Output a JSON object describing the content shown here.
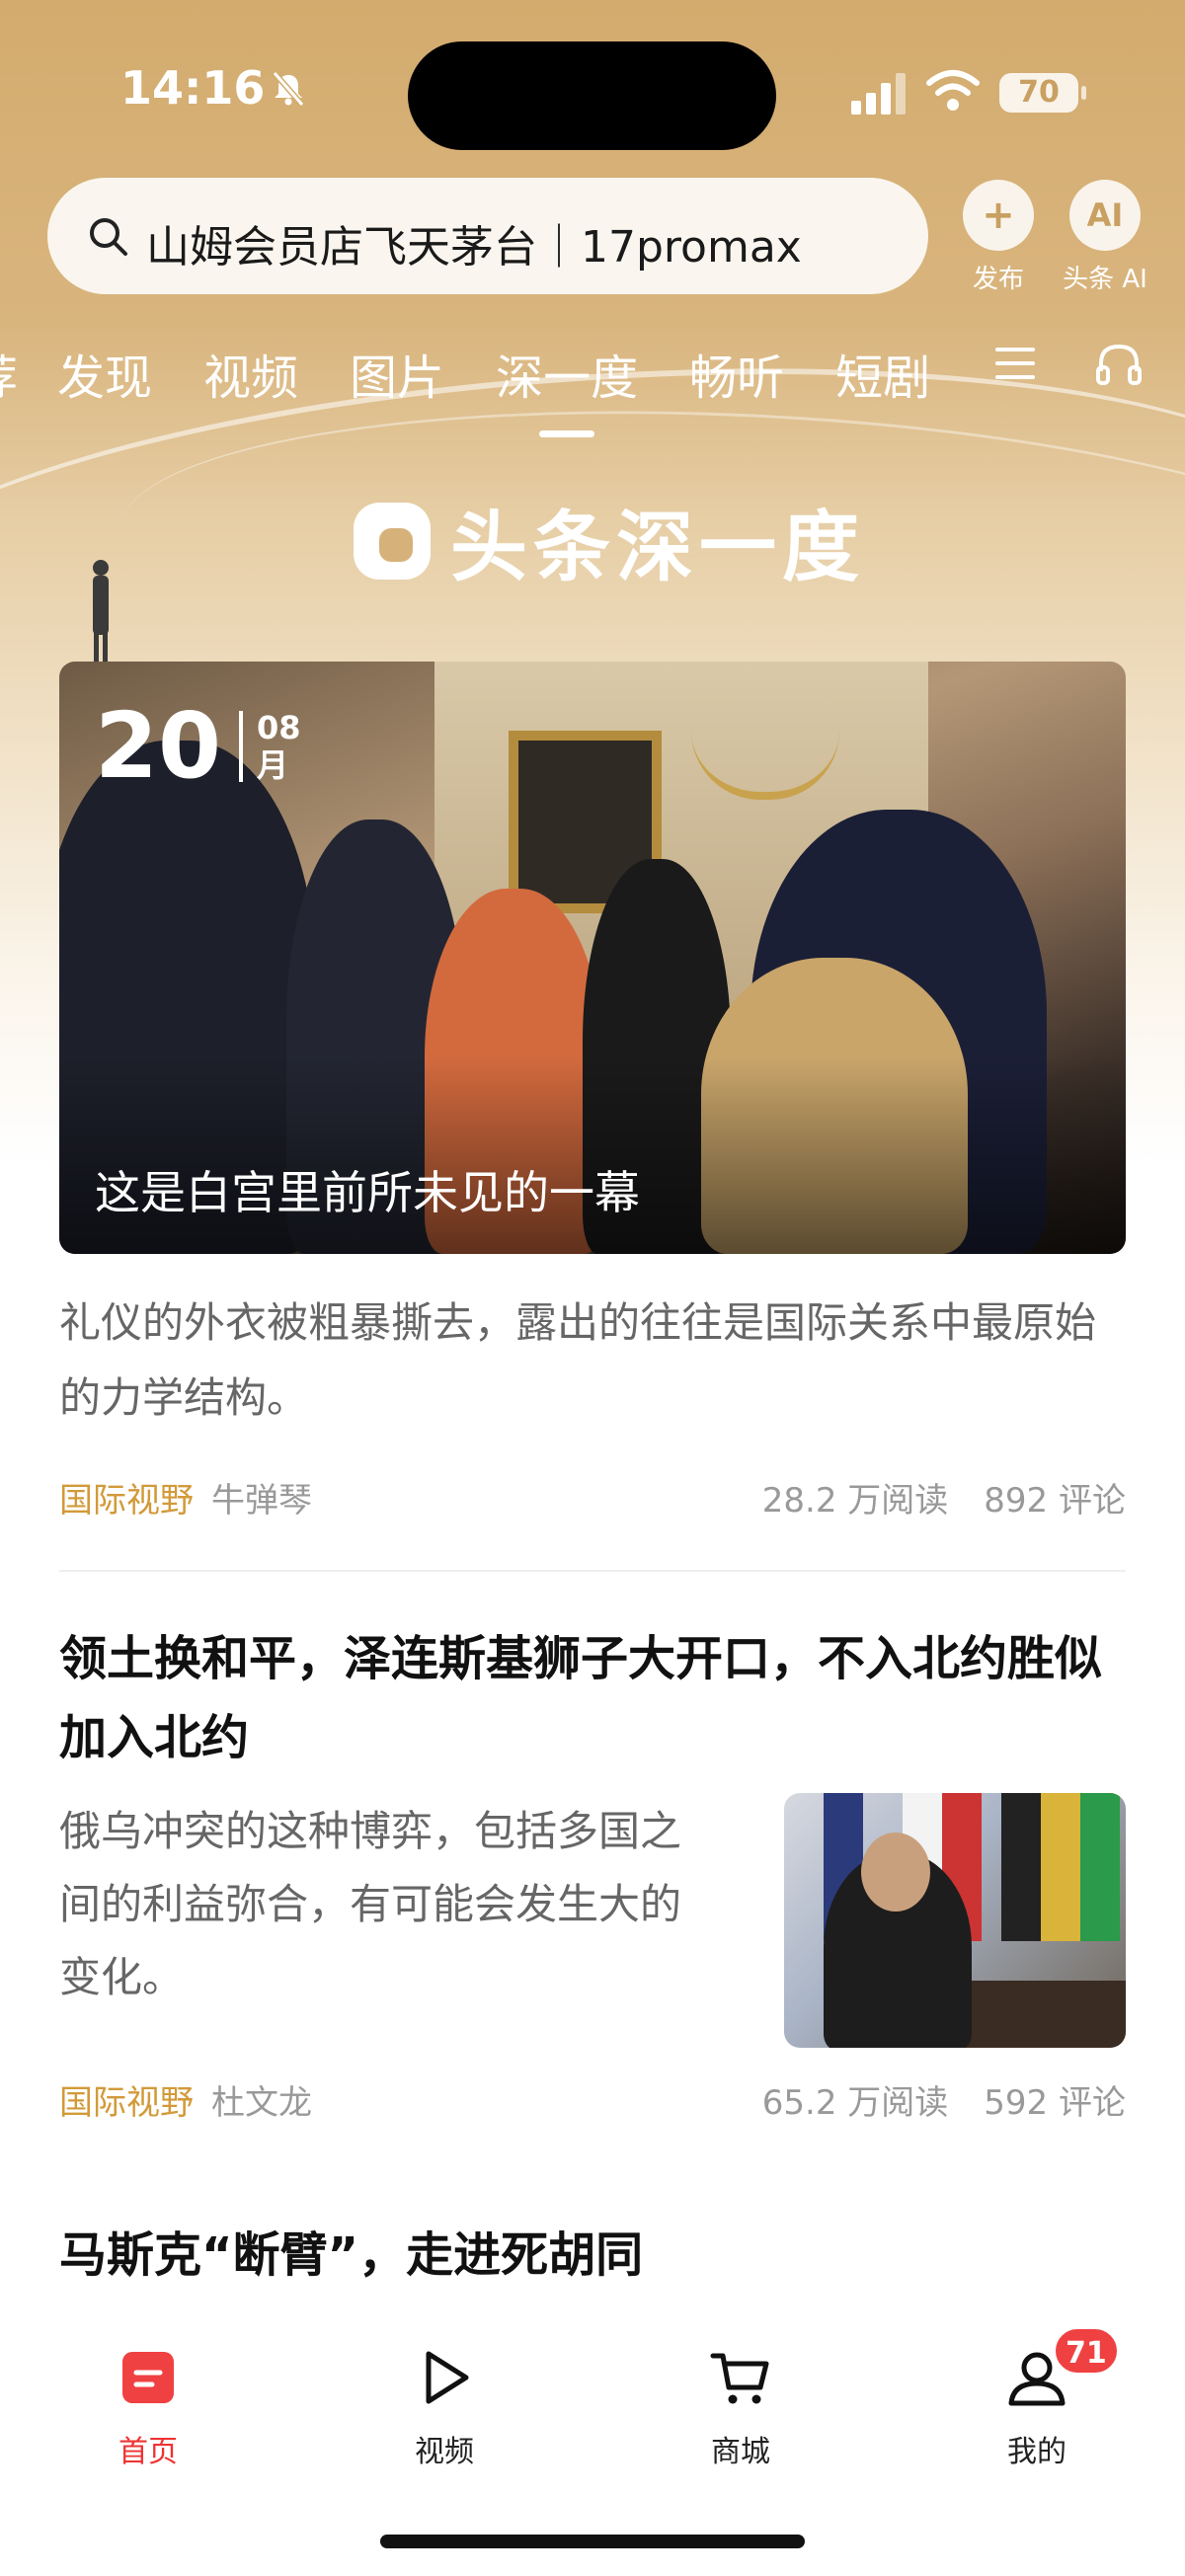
{
  "status_bar": {
    "time": "14:16",
    "battery": "70"
  },
  "search": {
    "text": "山姆会员店飞天茅台｜17promax"
  },
  "top_actions": {
    "publish_label": "发布",
    "ai_label": "头条 AI",
    "ai_icon_text": "AI",
    "publish_icon_text": "+"
  },
  "tabs": [
    {
      "label": "荐"
    },
    {
      "label": "发现"
    },
    {
      "label": "视频"
    },
    {
      "label": "图片"
    },
    {
      "label": "深一度",
      "active": true
    },
    {
      "label": "畅听"
    },
    {
      "label": "短剧"
    }
  ],
  "brand": {
    "name": "头条深一度"
  },
  "feature": {
    "day": "20",
    "month_num": "08",
    "month_unit": "月",
    "title": "这是白宫里前所未见的一幕",
    "summary": "礼仪的外衣被粗暴撕去，露出的往往是国际关系中最原始的力学结构。",
    "tag": "国际视野",
    "author": "牛弹琴",
    "reads": "28.2 万阅读",
    "comments": "892 评论"
  },
  "article2": {
    "title": "领土换和平，泽连斯基狮子大开口，不入北约胜似加入北约",
    "summary": "俄乌冲突的这种博弈，包括多国之间的利益弥合，有可能会发生大的变化。",
    "tag": "国际视野",
    "author": "杜文龙",
    "reads": "65.2 万阅读",
    "comments": "592 评论"
  },
  "article3": {
    "title": "马斯克“断臂”，走进死胡同"
  },
  "bottom_nav": {
    "items": [
      {
        "label": "首页",
        "icon": "home-icon",
        "active": true
      },
      {
        "label": "视频",
        "icon": "play-icon"
      },
      {
        "label": "商城",
        "icon": "cart-icon"
      },
      {
        "label": "我的",
        "icon": "profile-icon"
      }
    ],
    "profile_badge": "71"
  },
  "colors": {
    "accent": "#d29a3a",
    "header": "#d3ab6e",
    "active_nav": "#e33333",
    "badge": "#f04142"
  }
}
